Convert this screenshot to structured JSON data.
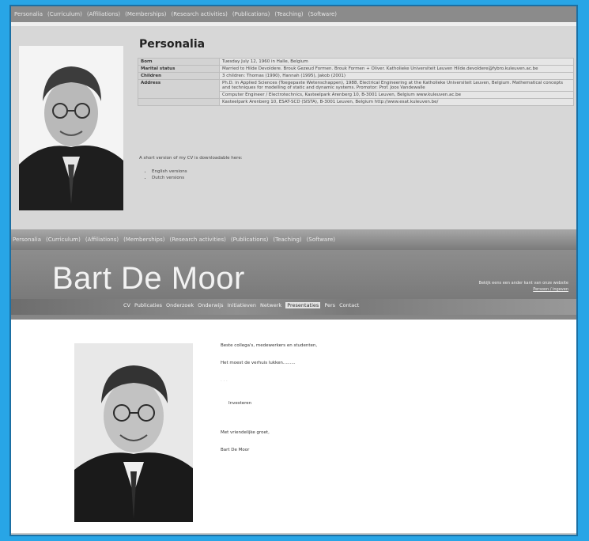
{
  "nav": {
    "items": [
      "Personalia",
      "(Curriculum)",
      "(Affiliations)",
      "(Memberships)",
      "(Research activities)",
      "(Publications)",
      "(Teaching)",
      "(Software)"
    ]
  },
  "personalia": {
    "title": "Personalia",
    "rows": [
      {
        "key": "Born",
        "value": "Tuesday July 12, 1960 in Halle, Belgium"
      },
      {
        "key": "Marital status",
        "value": "Married to Hilde Devoldere. Brouk Gezeud Formen. Brouk Formen + Oliver. Katholieke Universiteit Leuven Hilde.devoldere@fybro.kuleuven.ac.be"
      },
      {
        "key": "Children",
        "value": "3 children: Thomas (1990), Hannah (1995), Jakob (2001)"
      },
      {
        "key": "Address",
        "value": "Ph.D. in Applied Sciences (Toegepaste Wetenschappen), 1988, Electrical Engineering at the Katholieke Universiteit Leuven, Belgium. Mathematical concepts and techniques for modelling of static and dynamic systems. Promotor: Prof. Joos Vandewalle"
      },
      {
        "key": "",
        "value": "Computer Engineer / Electrotechnics, Kasteelpark Arenberg 10, B-3001 Leuven, Belgium  www.kuleuven.ac.be"
      },
      {
        "key": "",
        "value": "Kasteelpark Arenberg 10, ESAT-SCD (SISTA), B-3001 Leuven, Belgium  http://www.esat.kuleuven.be/"
      }
    ],
    "note": "A short version of my CV is downloadable here:",
    "langs": [
      "English versions",
      "Dutch versions"
    ]
  },
  "site": {
    "title": "Bart De Moor",
    "header_right_line1": "Bekijk eens een ander kant van onze website",
    "header_right_link": "Persoon / ingeven",
    "menu": [
      "CV",
      "Publicaties",
      "Onderzoek",
      "Onderwijs",
      "Initiatieven",
      "Netwerk",
      "Presentaties",
      "Pers",
      "Contact"
    ],
    "active_menu": "Presentaties"
  },
  "body_text": {
    "p1": "Beste collega's, medewerkers en studenten,",
    "p2": "Het moest de verhuis lukken.........",
    "dots": ". . .",
    "p3": "Investeren",
    "p4": "Met vriendelijke groet,",
    "p5": "Bart De Moor"
  },
  "colors": {
    "background": "#28a5e6",
    "header_gray": "#8d8d8d"
  }
}
